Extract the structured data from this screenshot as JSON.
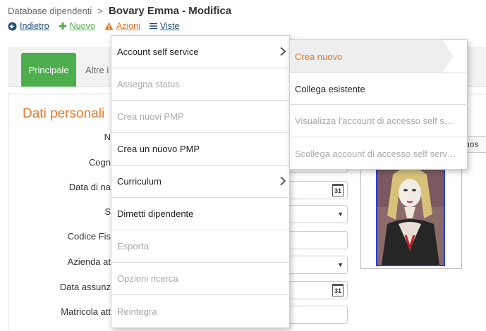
{
  "breadcrumb": {
    "parent": "Database dipendenti",
    "separator": ">",
    "title": "Bovary Emma - Modifica"
  },
  "toolbar": {
    "back": "Indietro",
    "new": "Nuovo",
    "actions": "Azioni",
    "views": "Viste"
  },
  "tabs": {
    "active": "Principale",
    "other": "Altre i"
  },
  "section": {
    "title": "Dati personali"
  },
  "fields": {
    "nome": "N",
    "cognome": "Cogn",
    "data_nascita": "Data di na",
    "sesso": "S",
    "codice_fiscale": "Codice Fis",
    "azienda": "Azienda at",
    "data_assunzione": "Data assunz",
    "matricola": "Matricola att"
  },
  "calendar_day": "31",
  "photo": {
    "choose_label": "chos"
  },
  "menu": {
    "account_self_service": "Account self service",
    "assegna_status": "Assegna status",
    "crea_nuovi_pmp": "Crea nuovi PMP",
    "crea_nuovo_pmp": "Crea un nuovo PMP",
    "curriculum": "Curriculum",
    "dimetti": "Dimetti dipendente",
    "esporta": "Esporta",
    "opzioni_ricerca": "Opzioni ricerca",
    "reintegra": "Reintegra"
  },
  "submenu": {
    "crea_nuovo": "Crea nuovo",
    "collega": "Collega esistente",
    "visualizza": "Visualizza l'account di accesso self s…",
    "scollega": "Scollega account di accesso self serv…"
  },
  "colors": {
    "accent": "#e07a2e",
    "green": "#4cae4c",
    "link": "#1f4e79",
    "photo_border": "#2b3fd6"
  }
}
